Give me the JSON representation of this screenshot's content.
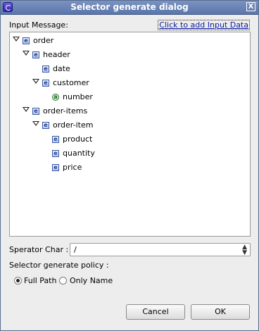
{
  "window": {
    "title": "Selector generate dialog",
    "close_glyph": "X"
  },
  "input_message_label": "Input Message:",
  "add_input_link": "Click to add Input Data",
  "tree": {
    "element_glyph": "e",
    "attribute_glyph": "a",
    "nodes": [
      {
        "label": "order",
        "kind": "element",
        "depth": 0,
        "expanded": true
      },
      {
        "label": "header",
        "kind": "element",
        "depth": 1,
        "expanded": true
      },
      {
        "label": "date",
        "kind": "element",
        "depth": 2
      },
      {
        "label": "customer",
        "kind": "element",
        "depth": 2,
        "expanded": true
      },
      {
        "label": "number",
        "kind": "attribute",
        "depth": 3
      },
      {
        "label": "order-items",
        "kind": "element",
        "depth": 1,
        "expanded": true
      },
      {
        "label": "order-item",
        "kind": "element",
        "depth": 2,
        "expanded": true
      },
      {
        "label": "product",
        "kind": "element",
        "depth": 3
      },
      {
        "label": "quantity",
        "kind": "element",
        "depth": 3
      },
      {
        "label": "price",
        "kind": "element",
        "depth": 3
      }
    ]
  },
  "separator": {
    "label": "Sperator Char :",
    "value": "/"
  },
  "policy": {
    "label": "Selector generate policy :",
    "options": [
      {
        "label": "Full Path",
        "selected": true
      },
      {
        "label": "Only Name",
        "selected": false
      }
    ]
  },
  "buttons": {
    "cancel": "Cancel",
    "ok": "OK"
  }
}
